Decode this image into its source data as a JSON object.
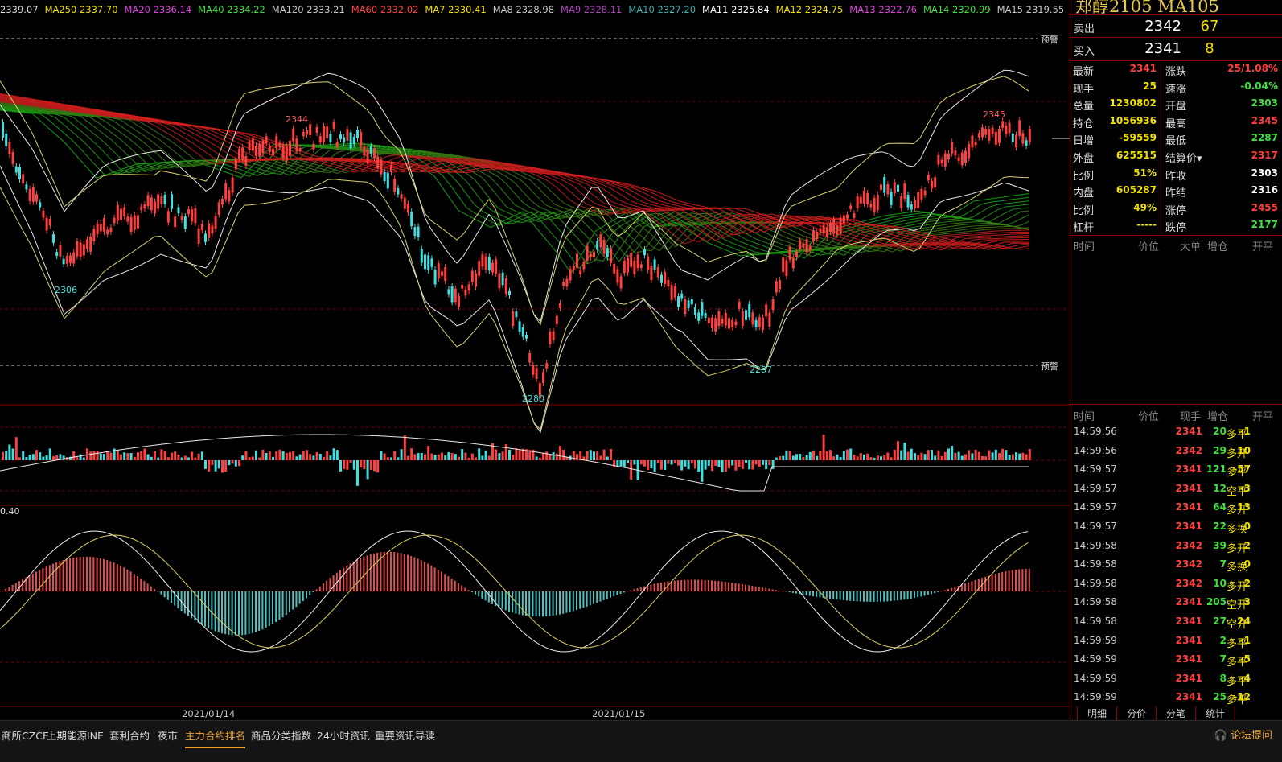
{
  "ma_bar": [
    {
      "label": "2339.07",
      "color": "#dddddd"
    },
    {
      "label": "MA250 2337.70",
      "color": "#f0e000"
    },
    {
      "label": "MA20 2336.14",
      "color": "#e040e0"
    },
    {
      "label": "MA40 2334.22",
      "color": "#40e040"
    },
    {
      "label": "MA120 2333.21",
      "color": "#c8c8c8"
    },
    {
      "label": "MA60 2332.02",
      "color": "#ff4040"
    },
    {
      "label": "MA7 2330.41",
      "color": "#f0e000"
    },
    {
      "label": "MA8 2328.98",
      "color": "#c8c8c8"
    },
    {
      "label": "MA9 2328.11",
      "color": "#b040c0"
    },
    {
      "label": "MA10 2327.20",
      "color": "#40b0b0"
    },
    {
      "label": "MA11 2325.84",
      "color": "#ffffff"
    },
    {
      "label": "MA12 2324.75",
      "color": "#f0e000"
    },
    {
      "label": "MA13 2322.76",
      "color": "#e040e0"
    },
    {
      "label": "MA14 2320.99",
      "color": "#40e040"
    },
    {
      "label": "MA15 2319.55",
      "color": "#c8c8c8"
    }
  ],
  "warn_label": "预警",
  "annotations": {
    "high_left": "2344",
    "low_left": "2306",
    "low_mid": "2280",
    "low_right": "2287",
    "high_right": "2345"
  },
  "osc_label": "0.40",
  "dates": [
    "2021/01/14",
    "2021/01/15"
  ],
  "title": "郑醇2105  MA105",
  "quote": {
    "sell_label": "卖出",
    "sell_price": "2342",
    "sell_vol": "67",
    "buy_label": "买入",
    "buy_price": "2341",
    "buy_vol": "8"
  },
  "stats_left": [
    {
      "k": "最新",
      "v": "2341",
      "c": "#ff4040"
    },
    {
      "k": "现手",
      "v": "25",
      "c": "#f0e000"
    },
    {
      "k": "总量",
      "v": "1230802",
      "c": "#f0e000"
    },
    {
      "k": "持仓",
      "v": "1056936",
      "c": "#f0e000"
    },
    {
      "k": "日增",
      "v": "-59559",
      "c": "#f0e000"
    },
    {
      "k": "外盘",
      "v": "625515",
      "c": "#f0e000"
    },
    {
      "k": "比例",
      "v": "51%",
      "c": "#f0e000"
    },
    {
      "k": "内盘",
      "v": "605287",
      "c": "#f0e000"
    },
    {
      "k": "比例",
      "v": "49%",
      "c": "#f0e000"
    },
    {
      "k": "杠杆",
      "v": "-----",
      "c": "#f0e000"
    }
  ],
  "stats_right": [
    {
      "k": "涨跌",
      "v": "25/1.08%",
      "c": "#ff4040"
    },
    {
      "k": "速涨",
      "v": "-0.04%",
      "c": "#40e040"
    },
    {
      "k": "开盘",
      "v": "2303",
      "c": "#40e040"
    },
    {
      "k": "最高",
      "v": "2345",
      "c": "#ff4040"
    },
    {
      "k": "最低",
      "v": "2287",
      "c": "#40e040"
    },
    {
      "k": "结算价▾",
      "v": "2317",
      "c": "#ff4040"
    },
    {
      "k": "昨收",
      "v": "2303",
      "c": "#ffffff"
    },
    {
      "k": "昨结",
      "v": "2316",
      "c": "#ffffff"
    },
    {
      "k": "涨停",
      "v": "2455",
      "c": "#ff4040"
    },
    {
      "k": "跌停",
      "v": "2177",
      "c": "#40e040"
    }
  ],
  "big_headers": [
    "时间",
    "价位",
    "大单",
    "增仓",
    "开平"
  ],
  "tick_headers": [
    "时间",
    "价位",
    "现手",
    "增仓",
    "开平"
  ],
  "ticks": [
    {
      "t": "14:59:56",
      "p": "2341",
      "v": "20",
      "d": "-1",
      "o": "多平"
    },
    {
      "t": "14:59:56",
      "p": "2342",
      "v": "29",
      "d": "10",
      "o": "多开"
    },
    {
      "t": "14:59:57",
      "p": "2341",
      "v": "121",
      "d": "-57",
      "o": "多平"
    },
    {
      "t": "14:59:57",
      "p": "2341",
      "v": "12",
      "d": "-3",
      "o": "空平"
    },
    {
      "t": "14:59:57",
      "p": "2341",
      "v": "64",
      "d": "13",
      "o": "多开"
    },
    {
      "t": "14:59:57",
      "p": "2341",
      "v": "22",
      "d": "0",
      "o": "多换"
    },
    {
      "t": "14:59:58",
      "p": "2342",
      "v": "39",
      "d": "2",
      "o": "多开"
    },
    {
      "t": "14:59:58",
      "p": "2342",
      "v": "7",
      "d": "0",
      "o": "多换"
    },
    {
      "t": "14:59:58",
      "p": "2342",
      "v": "10",
      "d": "2",
      "o": "多开"
    },
    {
      "t": "14:59:58",
      "p": "2341",
      "v": "205",
      "d": "3",
      "o": "空开"
    },
    {
      "t": "14:59:58",
      "p": "2341",
      "v": "27",
      "d": "24",
      "o": "空开"
    },
    {
      "t": "14:59:59",
      "p": "2341",
      "v": "2",
      "d": "-1",
      "o": "多平"
    },
    {
      "t": "14:59:59",
      "p": "2341",
      "v": "7",
      "d": "-5",
      "o": "多平"
    },
    {
      "t": "14:59:59",
      "p": "2341",
      "v": "8",
      "d": "-4",
      "o": "多平"
    },
    {
      "t": "14:59:59",
      "p": "2341",
      "v": "25",
      "d": "-12",
      "o": "多平"
    }
  ],
  "side_tabs": [
    "明细",
    "分价",
    "分笔",
    "统计"
  ],
  "bottom_tabs": [
    "商所CZCE",
    "上期能源INE",
    "套利合约",
    "夜市",
    "主力合约排名",
    "商品分类指数",
    "24小时资讯",
    "重要资讯导读"
  ],
  "active_bottom_tab": 4,
  "forum": "论坛提问",
  "colors": {
    "up": "#ff4040",
    "down": "#40e0e0",
    "frame": "#8a0000"
  }
}
